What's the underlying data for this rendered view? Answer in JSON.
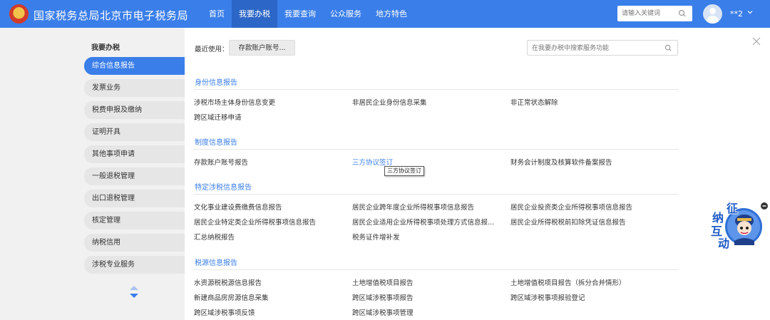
{
  "header": {
    "site_title": "国家税务总局北京市电子税务局",
    "nav": [
      "首页",
      "我要办税",
      "我要查询",
      "公众服务",
      "地方特色"
    ],
    "search_placeholder": "请输入关键词",
    "user_name": "**2",
    "brand_color": "#3a7ee9"
  },
  "sidebar": {
    "title": "我要办税",
    "items": [
      "综合信息报告",
      "发票业务",
      "税费申报及缴纳",
      "证明开具",
      "其他事项申请",
      "一般退税管理",
      "出口退税管理",
      "核定管理",
      "纳税信用",
      "涉税专业服务"
    ],
    "active_index": 0
  },
  "main": {
    "recent_label": "最近使用：",
    "recent_items": [
      "存款账户账号..."
    ],
    "search_placeholder": "在我要办税中搜索服务功能",
    "sections": [
      {
        "title": "身份信息报告",
        "rows": [
          [
            "涉税市场主体身份信息变更",
            "非居民企业身份信息采集",
            "非正常状态解除"
          ],
          [
            "跨区域迁移申请"
          ]
        ]
      },
      {
        "title": "制度信息报告",
        "rows": [
          [
            "存款账户账号报告",
            "三方协议签订",
            "财务会计制度及核算软件备案报告"
          ]
        ]
      },
      {
        "title": "特定涉税信息报告",
        "rows": [
          [
            "文化事业建设费缴费信息报告",
            "居民企业跨年度企业所得税事项信息报告",
            "居民企业投资类企业所得税事项信息报告"
          ],
          [
            "居民企业特定类企业所得税事项信息报告",
            "居民企业适用企业所得税事项处理方式信息报...",
            "居民企业所得税税前扣除凭证信息报告"
          ],
          [
            "汇总纳税报告",
            "税务证件增补发"
          ]
        ]
      },
      {
        "title": "税源信息报告",
        "rows": [
          [
            "水资源税税源信息报告",
            "土地增值税项目报告",
            "土地增值税项目报告（拆分合并情形）"
          ],
          [
            "新建商品房房源信息采集",
            "跨区域涉税事项报告",
            "跨区域涉税事项报验登记"
          ],
          [
            "跨区域涉税事项反馈",
            "跨区域涉税事项管理"
          ]
        ]
      }
    ],
    "tooltip": "三方协议签订"
  },
  "mascot": {
    "chars": [
      "征",
      "纳",
      "互",
      "动"
    ]
  }
}
